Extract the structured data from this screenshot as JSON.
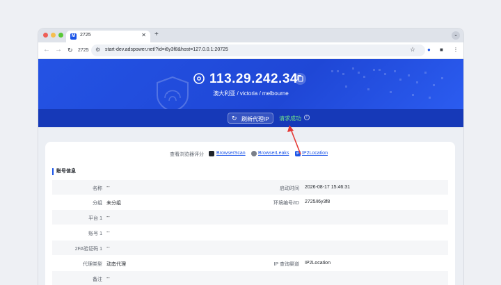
{
  "browser": {
    "tab_title": "2725",
    "tab_favicon": "M",
    "tab_close": "✕",
    "new_tab": "+",
    "tab_menu": "⌄",
    "toolbar_label": "2725",
    "url": "start-dev.adspower.net/?id=i6y3f8&host=127.0.0.1:20725",
    "icons": {
      "back": "arrow-left-icon",
      "forward": "arrow-right-icon",
      "reload": "reload-icon",
      "site": "site-settings-icon",
      "bookmark": "star-icon",
      "profile": "profile-icon",
      "camera": "camera-icon",
      "more": "more-vertical-icon"
    }
  },
  "hero": {
    "ip": "113.29.242.34",
    "location": "澳大利亚 / victoria / melbourne",
    "refresh_label": "刷新代理IP",
    "status": "请求成功",
    "info": "!",
    "colors": {
      "background": "#2453e4",
      "subbar": "#1639b8",
      "success": "#6fe08a"
    }
  },
  "checkers": {
    "label": "查看浏览器评分",
    "items": [
      {
        "name": "BrowserScan"
      },
      {
        "name": "BrowserLeaks"
      },
      {
        "name": "IP2Location",
        "badge": "IP"
      }
    ]
  },
  "account": {
    "title": "账号信息",
    "rows": [
      {
        "label": "名称",
        "value": "--",
        "label2": "启动时间",
        "value2": "2026-08-17 15:46:31"
      },
      {
        "label": "分组",
        "value": "未分组",
        "label2": "环境编号/ID",
        "value2": "2725/i6y3f8"
      },
      {
        "label": "平台 1",
        "value": "--"
      },
      {
        "label": "账号 1",
        "value": "--"
      },
      {
        "label": "2FA验证码 1",
        "value": "--"
      },
      {
        "label": "代理类型",
        "value": "动态代理",
        "label2": "IP 查询渠道",
        "value2": "IP2Location"
      },
      {
        "label": "备注",
        "value": "--"
      }
    ]
  }
}
